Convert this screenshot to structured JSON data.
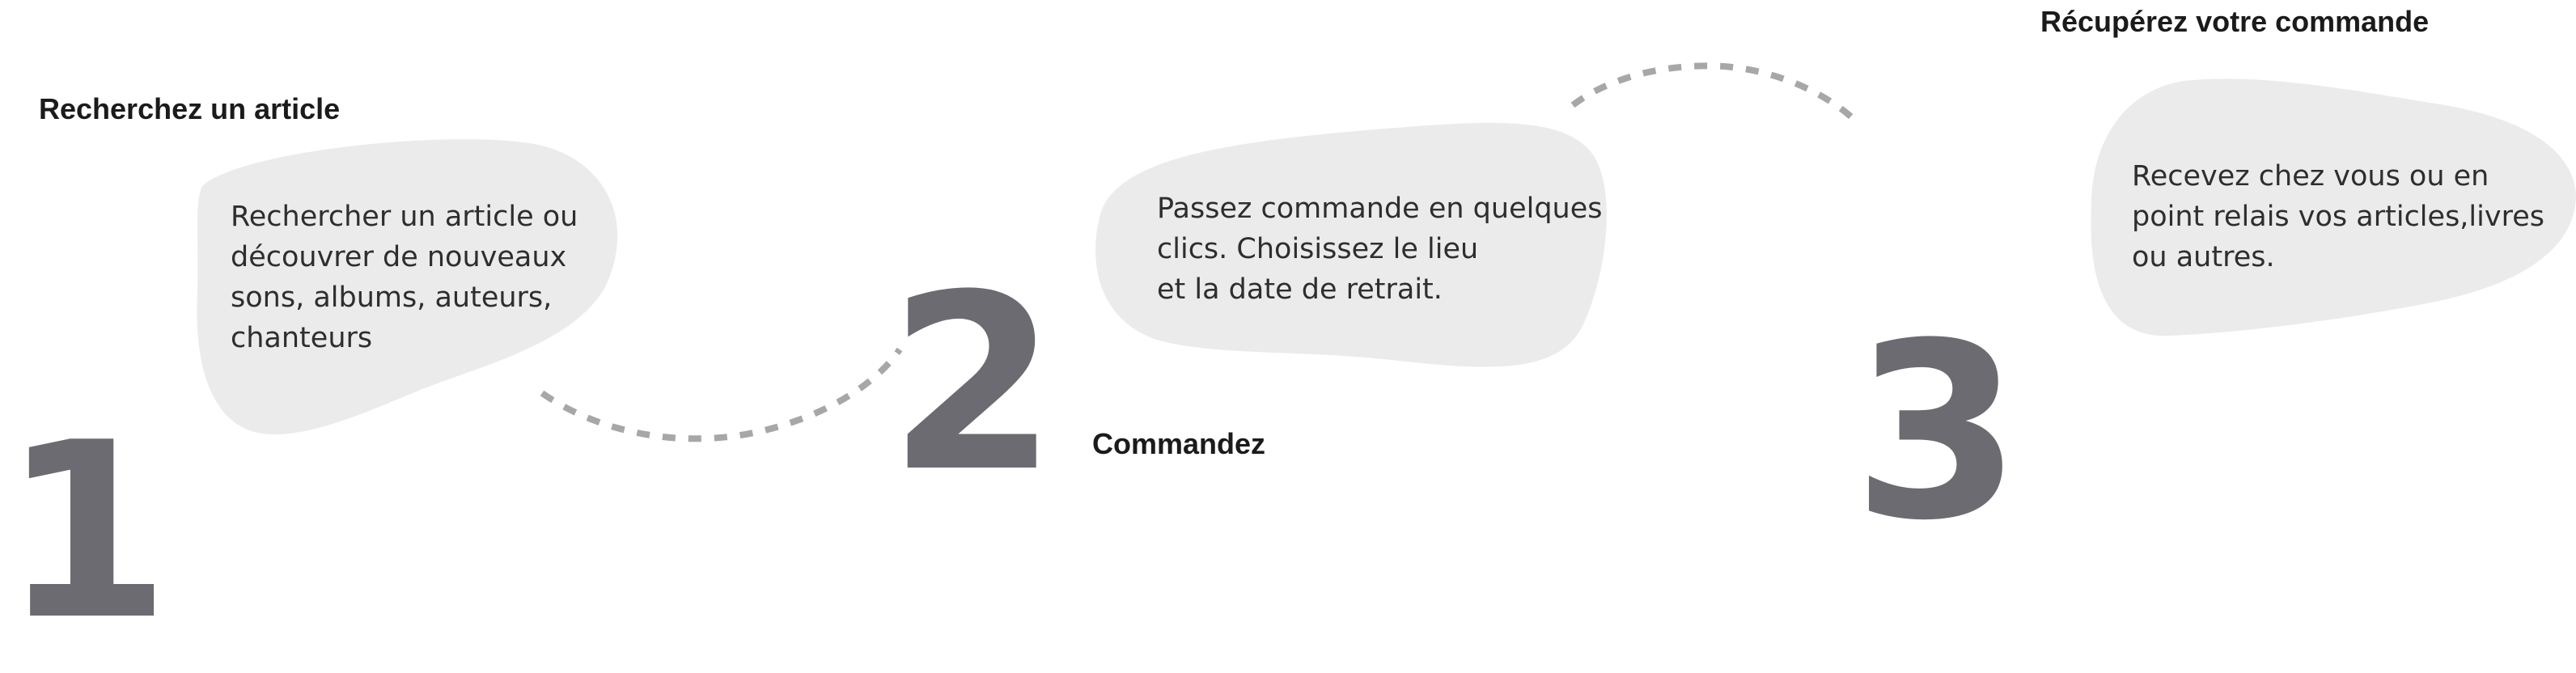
{
  "steps": [
    {
      "number": "1",
      "title": "Recherchez un article",
      "lines": [
        "Rechercher un article ou",
        "découvrer de nouveaux",
        "sons, albums, auteurs,",
        "chanteurs"
      ]
    },
    {
      "number": "2",
      "title": "Commandez",
      "lines": [
        "Passez commande en quelques",
        "clics. Choisissez le lieu",
        "et la date de retrait."
      ]
    },
    {
      "number": "3",
      "title": "Récupérez votre commande",
      "lines": [
        "Recevez chez vous ou en",
        "point relais vos articles,livres",
        "ou autres."
      ]
    }
  ],
  "colors": {
    "blob": "#ebebeb",
    "number": "#6b6b71",
    "dashes": "#a7a7a7",
    "title": "#1b1b1b",
    "text": "#2e2e2e"
  }
}
